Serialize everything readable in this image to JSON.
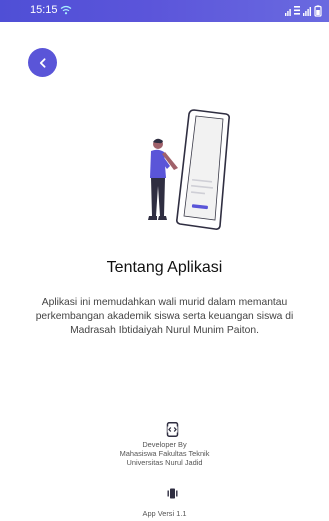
{
  "status_bar": {
    "time": "15:15",
    "icons": [
      "wifi-icon",
      "signal-icon",
      "lte-icon",
      "signal-icon",
      "battery-icon"
    ]
  },
  "header": {
    "back_icon": "chevron-left-icon"
  },
  "about": {
    "title": "Tentang Aplikasi",
    "description_lines": [
      "Aplikasi ini memudahkan wali murid dalam memantau",
      "perkembangan akademik siswa serta keuangan siswa di",
      "Madrasah Ibtidaiyah Nurul Munim Paiton."
    ]
  },
  "developer": {
    "icon": "developer-mode-icon",
    "lines": [
      "Developer By",
      "Mahasiswa Fakultas Teknik",
      "Universitas Nurul Jadid"
    ]
  },
  "version": {
    "icon": "vibration-icon",
    "label": "App Versi 1.1"
  },
  "colors": {
    "accent": "#5a55d8",
    "status_bar": "#5552d8",
    "title_text": "#111111",
    "body_text": "#444444"
  }
}
